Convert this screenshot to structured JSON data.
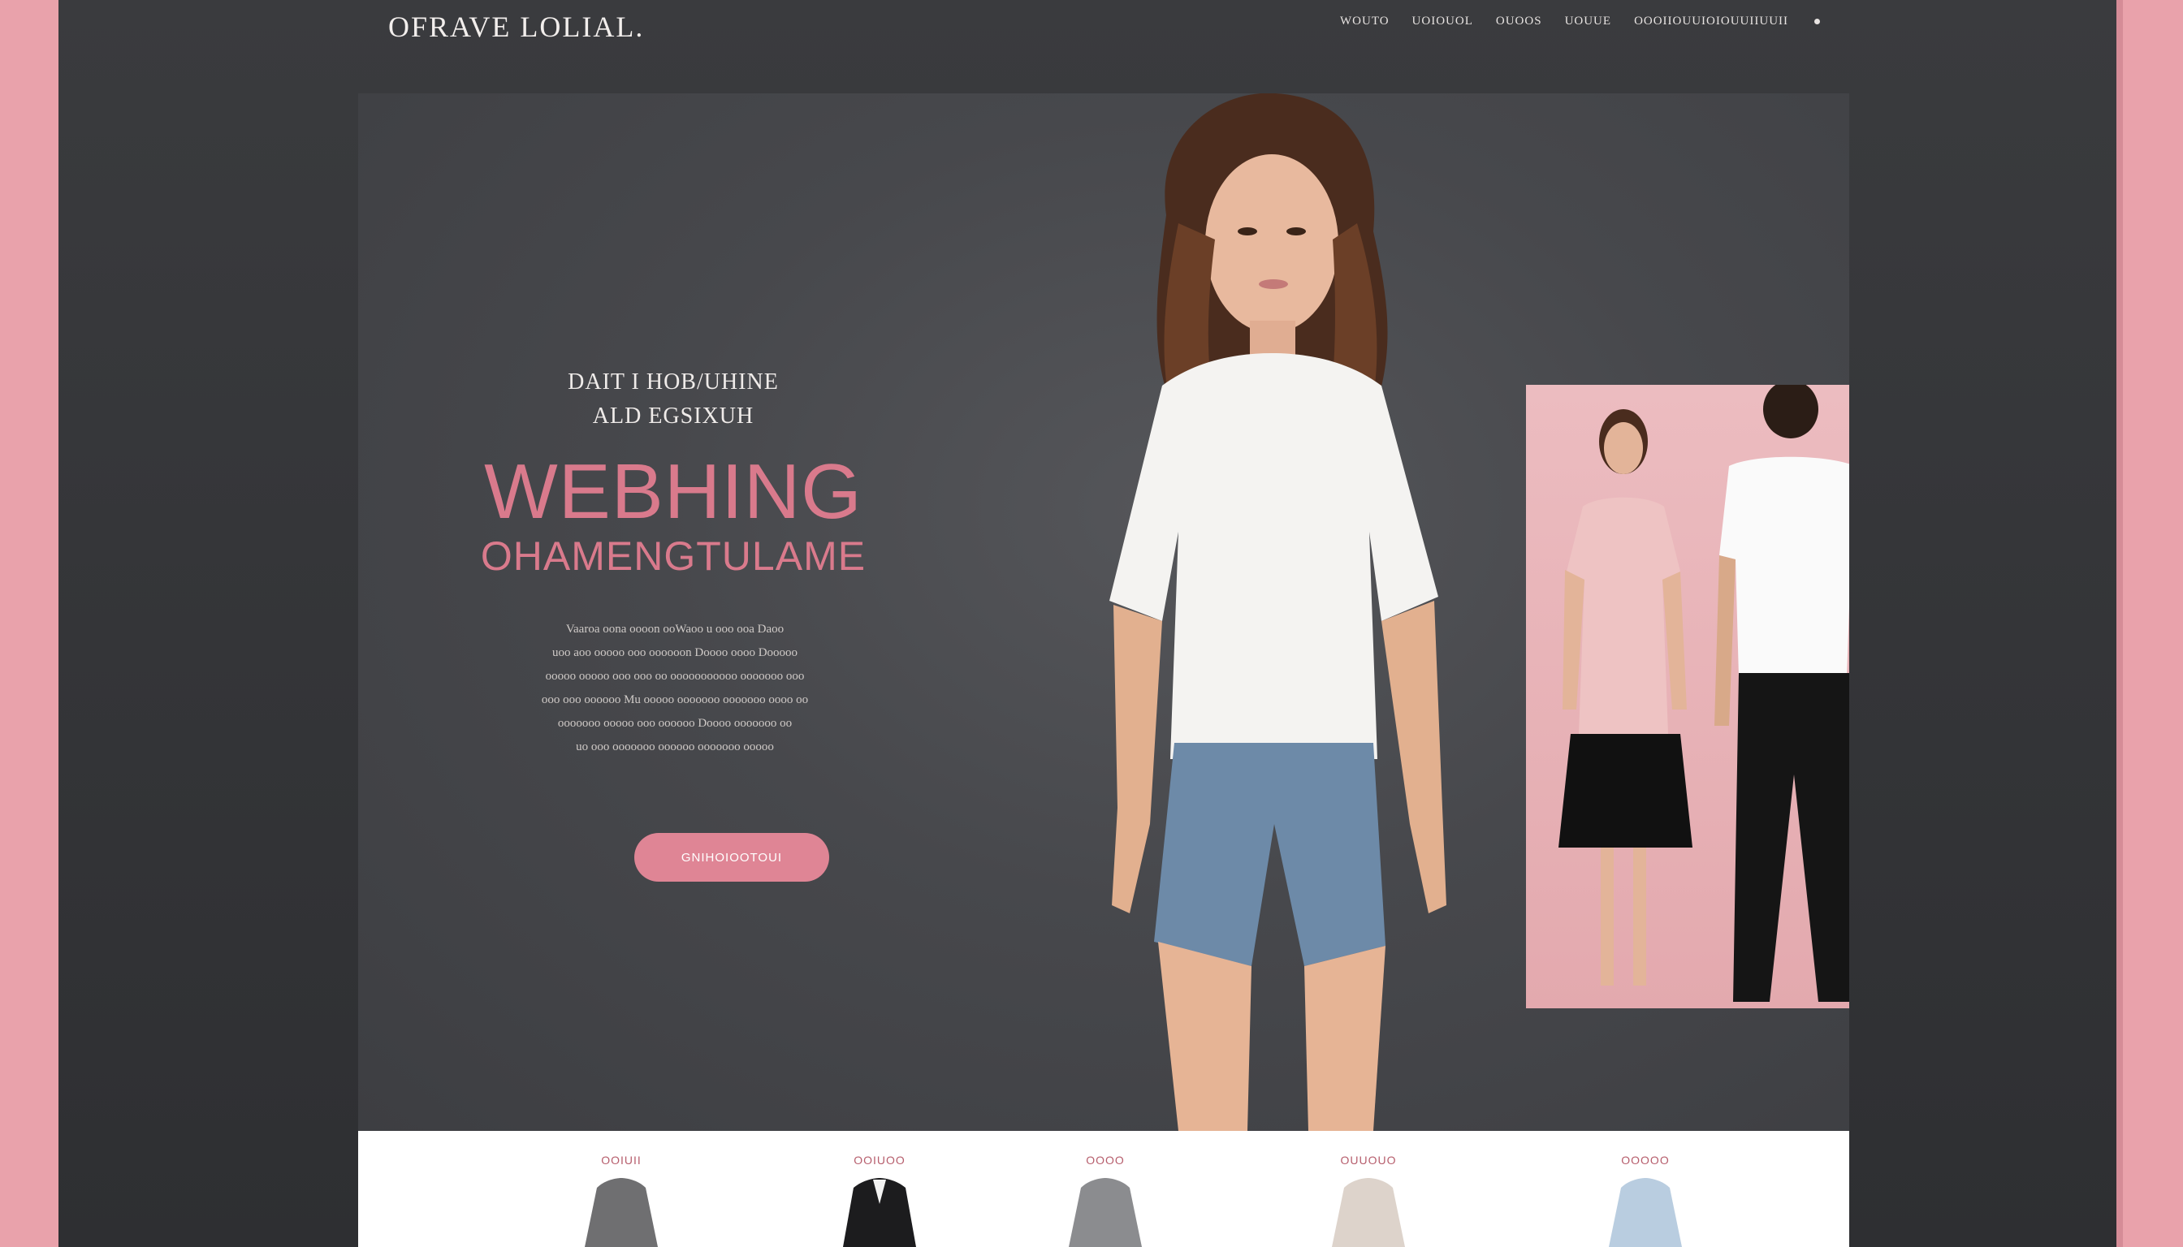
{
  "site": {
    "logo": "OFRAVE LOLIAL."
  },
  "nav": {
    "items": [
      "WOUTO",
      "UOIOUOL",
      "OUOOS",
      "UOUUE",
      "OOOIIOUUIOIOUUIIUUII"
    ]
  },
  "hero": {
    "eyebrow_line1": "DAIT I HOB/UHINE",
    "eyebrow_line2": "ALD EGSIXUH",
    "headline_line1": "WEBHING",
    "headline_line2": "OHAMENGTULAME",
    "body_lines": [
      "Vaaroa oona oooon ooWaoo u ooo ooa Daoo",
      "uoo aoo ooooo ooo oooooon Doooo oooo Dooooo",
      "ooooo ooooo ooo ooo oo ooooooooooo ooooooo ooo",
      "ooo ooo oooooo Mu ooooo ooooooo ooooooo oooo oo",
      "ooooooo ooooo ooo oooooo Doooo ooooooo oo",
      "uo ooo ooooooo oooooo ooooooo ooooo"
    ],
    "cta_label": "GNIHOIOOTOUI"
  },
  "products": {
    "items": [
      {
        "label": "OOIUII",
        "color": "#6f6f71"
      },
      {
        "label": "OOIUOO",
        "color": "#1c1c1e"
      },
      {
        "label": "OOOO",
        "color": "#8b8c8f"
      },
      {
        "label": "OUUOUO",
        "color": "#ddd3cb"
      },
      {
        "label": "OOOOO",
        "color": "#b9cde0"
      }
    ]
  },
  "colors": {
    "accent": "#df8595",
    "headline": "#d97a8c",
    "background_border": "#e9a2ab",
    "frame": "#37383b"
  }
}
